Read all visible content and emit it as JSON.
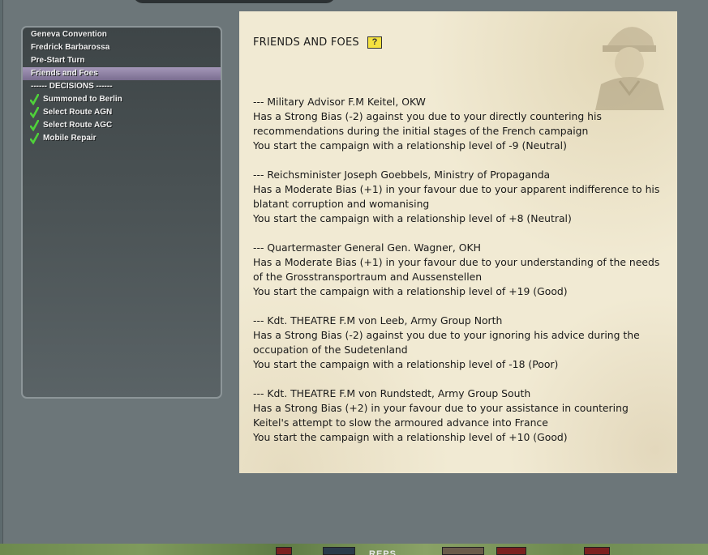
{
  "sidebar": {
    "items": [
      {
        "label": "Geneva Convention",
        "kind": "item"
      },
      {
        "label": "Fredrick Barbarossa",
        "kind": "item"
      },
      {
        "label": "Pre-Start Turn",
        "kind": "item"
      },
      {
        "label": "Friends and Foes",
        "kind": "active"
      },
      {
        "label": "------ DECISIONS ------",
        "kind": "header"
      },
      {
        "label": "Summoned to Berlin",
        "kind": "decision"
      },
      {
        "label": "Select Route AGN",
        "kind": "decision"
      },
      {
        "label": "Select Route AGC",
        "kind": "decision"
      },
      {
        "label": "Mobile Repair",
        "kind": "decision"
      }
    ]
  },
  "panel": {
    "title": "FRIENDS AND FOES",
    "help_label": "?",
    "entries": [
      {
        "heading": "--- Military Advisor F.M Keitel, OKW",
        "lines": [
          "Has a Strong Bias (-2) against you due to your directly countering his",
          "recommendations during the initial stages of the French campaign",
          "You start the campaign with a relationship level of -9 (Neutral)"
        ]
      },
      {
        "heading": "--- Reichsminister Joseph Goebbels, Ministry of Propaganda",
        "lines": [
          "Has a Moderate Bias (+1) in your favour due to your apparent indifference to his",
          "blatant corruption and womanising",
          "You start the campaign with a relationship level of +8 (Neutral)"
        ]
      },
      {
        "heading": "--- Quartermaster General Gen. Wagner, OKH",
        "lines": [
          "Has a Moderate Bias (+1) in your favour due to your understanding of the needs",
          "of the Grosstransportraum and Aussenstellen",
          "You start the campaign with a relationship level of +19 (Good)"
        ]
      },
      {
        "heading": "--- Kdt. THEATRE F.M von Leeb, Army Group North",
        "lines": [
          "Has a Strong Bias (-2) against you due to your ignoring his advice during the",
          "occupation of the Sudetenland",
          "You start the campaign with a relationship level of -18 (Poor)"
        ]
      },
      {
        "heading": "--- Kdt. THEATRE F.M von Rundstedt, Army Group South",
        "lines": [
          "Has a Strong Bias (+2) in your favour due to your assistance in countering",
          "Keitel's attempt to slow the armoured advance into France",
          "You start the campaign with a relationship level of +10 (Good)"
        ]
      }
    ]
  },
  "bottom_label": "REPS",
  "colors": {
    "accent_active": "#8f82a6",
    "check": "#4fd13a",
    "panel_bg": "#f1ead3",
    "help_bg": "#f5e23f"
  }
}
